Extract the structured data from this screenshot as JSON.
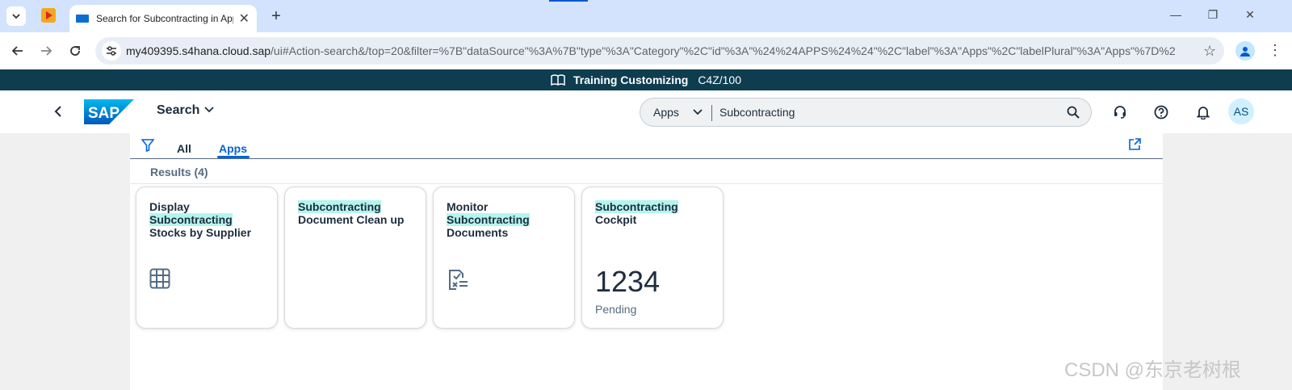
{
  "browser": {
    "tab_title": "Search for Subcontracting in Apps",
    "tab_close": "✕",
    "new_tab": "+",
    "url_domain": "my409395.s4hana.cloud.sap",
    "url_rest": "/ui#Action-search&/top=20&filter=%7B\"dataSource\"%3A%7B\"type\"%3A\"Category\"%2C\"id\"%3A\"%24%24APPS%24%24\"%2C\"label\"%3A\"Apps\"%2C\"labelPlural\"%3A\"Apps\"%7D%2C\"s...",
    "minimize": "—",
    "restore": "❐",
    "close": "✕",
    "star": "☆",
    "menu": "⋮"
  },
  "system": {
    "name": "Training Customizing",
    "client": "C4Z/100"
  },
  "shell": {
    "title": "Search",
    "search_scope": "Apps",
    "search_value": "Subcontracting",
    "avatar_initials": "AS"
  },
  "tabs": {
    "all": "All",
    "apps": "Apps"
  },
  "results_label": "Results (4)",
  "tiles": [
    {
      "pre": "Display",
      "highlight": "Subcontracting",
      "post": "Stocks by Supplier",
      "icon": "grid-table-icon"
    },
    {
      "pre": "",
      "highlight": "Subcontracting",
      "post": "Document Clean up",
      "icon": ""
    },
    {
      "pre": "Monitor",
      "highlight": "Subcontracting",
      "post": "Documents",
      "icon": "document-check-icon"
    },
    {
      "pre": "",
      "highlight": "Subcontracting",
      "post": "Cockpit",
      "kpi_value": "1234",
      "kpi_label": "Pending"
    }
  ],
  "watermark": "CSDN @东京老树根",
  "colors": {
    "system_bar": "#0e3d4f",
    "highlight": "#b4f5ee",
    "accent": "#0064d9"
  }
}
